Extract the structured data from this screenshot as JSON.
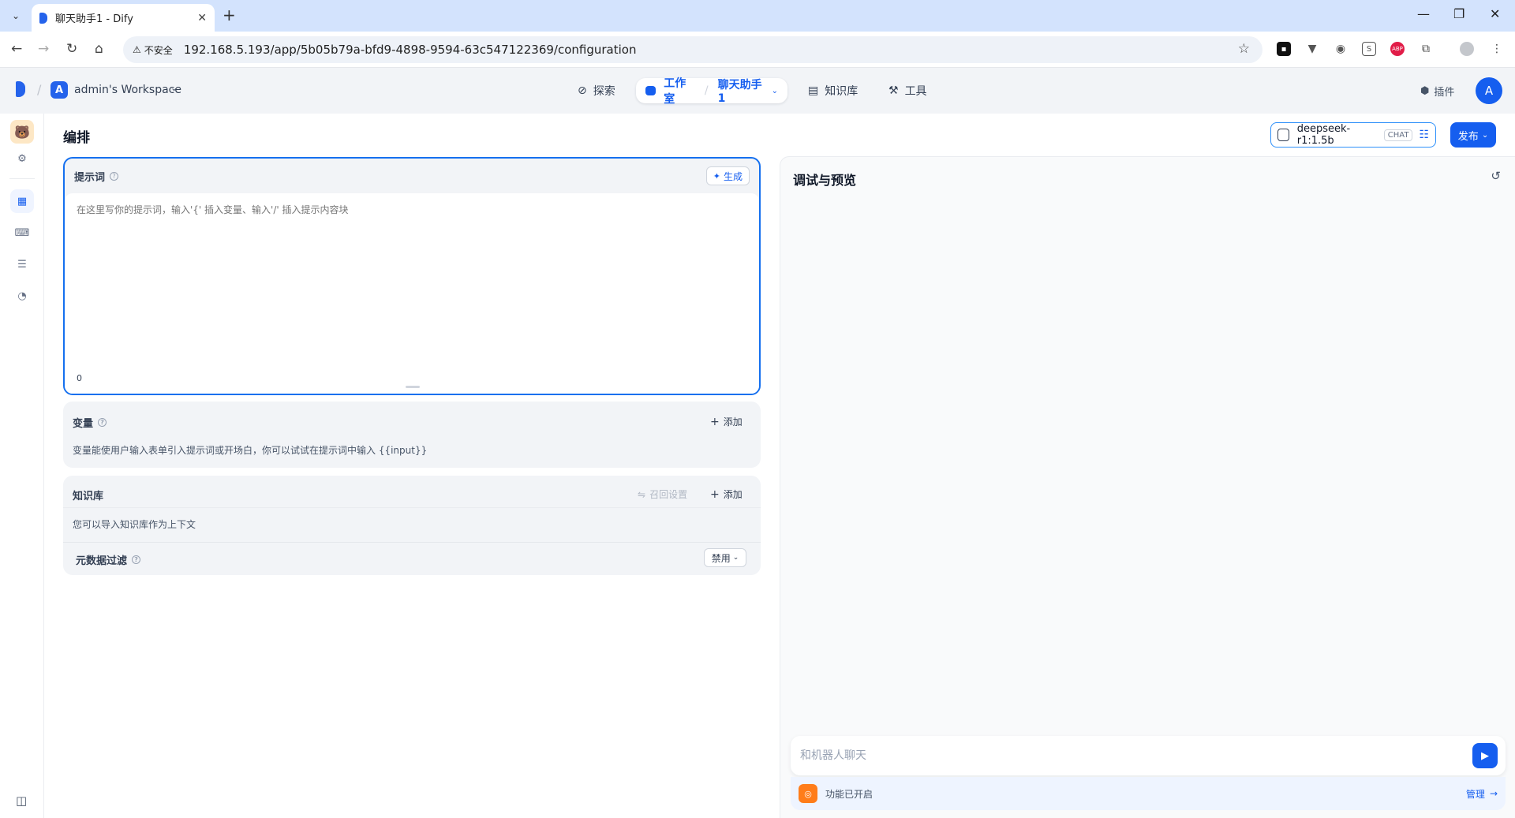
{
  "browser": {
    "tab_title": "聊天助手1 - Dify",
    "new_tab": "+",
    "close_tab": "✕",
    "security_label": "不安全",
    "url": "192.168.5.193/app/5b05b79a-bfd9-4898-9594-63c547122369/configuration",
    "extensions": [
      "extension-puzzle",
      "ublock",
      "shield",
      "s-ext",
      "abp",
      "puzzle"
    ],
    "window_controls": [
      "—",
      "❐",
      "✕"
    ]
  },
  "header": {
    "workspace_initial": "A",
    "workspace_name": "admin's Workspace",
    "nav": {
      "explore": "探索",
      "studio": "工作室",
      "app_name": "聊天助手1",
      "knowledge": "知识库",
      "tools": "工具"
    },
    "plugins": "插件",
    "user_initial": "A"
  },
  "page": {
    "title": "编排",
    "model_name": "deepseek-r1:1.5b",
    "model_mode": "CHAT",
    "publish": "发布"
  },
  "prompt": {
    "label": "提示词",
    "generate": "生成",
    "placeholder": "在这里写你的提示词，输入'{' 插入变量、输入'/' 插入提示内容块",
    "char_count": "0"
  },
  "variables": {
    "title": "变量",
    "add": "添加",
    "description": "变量能使用户输入表单引入提示词或开场白，你可以试试在提示词中输入 {{input}}"
  },
  "knowledge": {
    "title": "知识库",
    "recall_settings": "召回设置",
    "add": "添加",
    "description": "您可以导入知识库作为上下文",
    "metadata_filter": "元数据过滤",
    "metadata_value": "禁用"
  },
  "debug": {
    "title": "调试与预览",
    "chat_placeholder": "和机器人聊天",
    "features_enabled": "功能已开启",
    "manage": "管理"
  },
  "colors": {
    "primary": "#155eef",
    "header_bg": "#f2f4f7",
    "chrome_tab_bg": "#d3e3fd",
    "feature_icon": "#ff7d1a"
  }
}
